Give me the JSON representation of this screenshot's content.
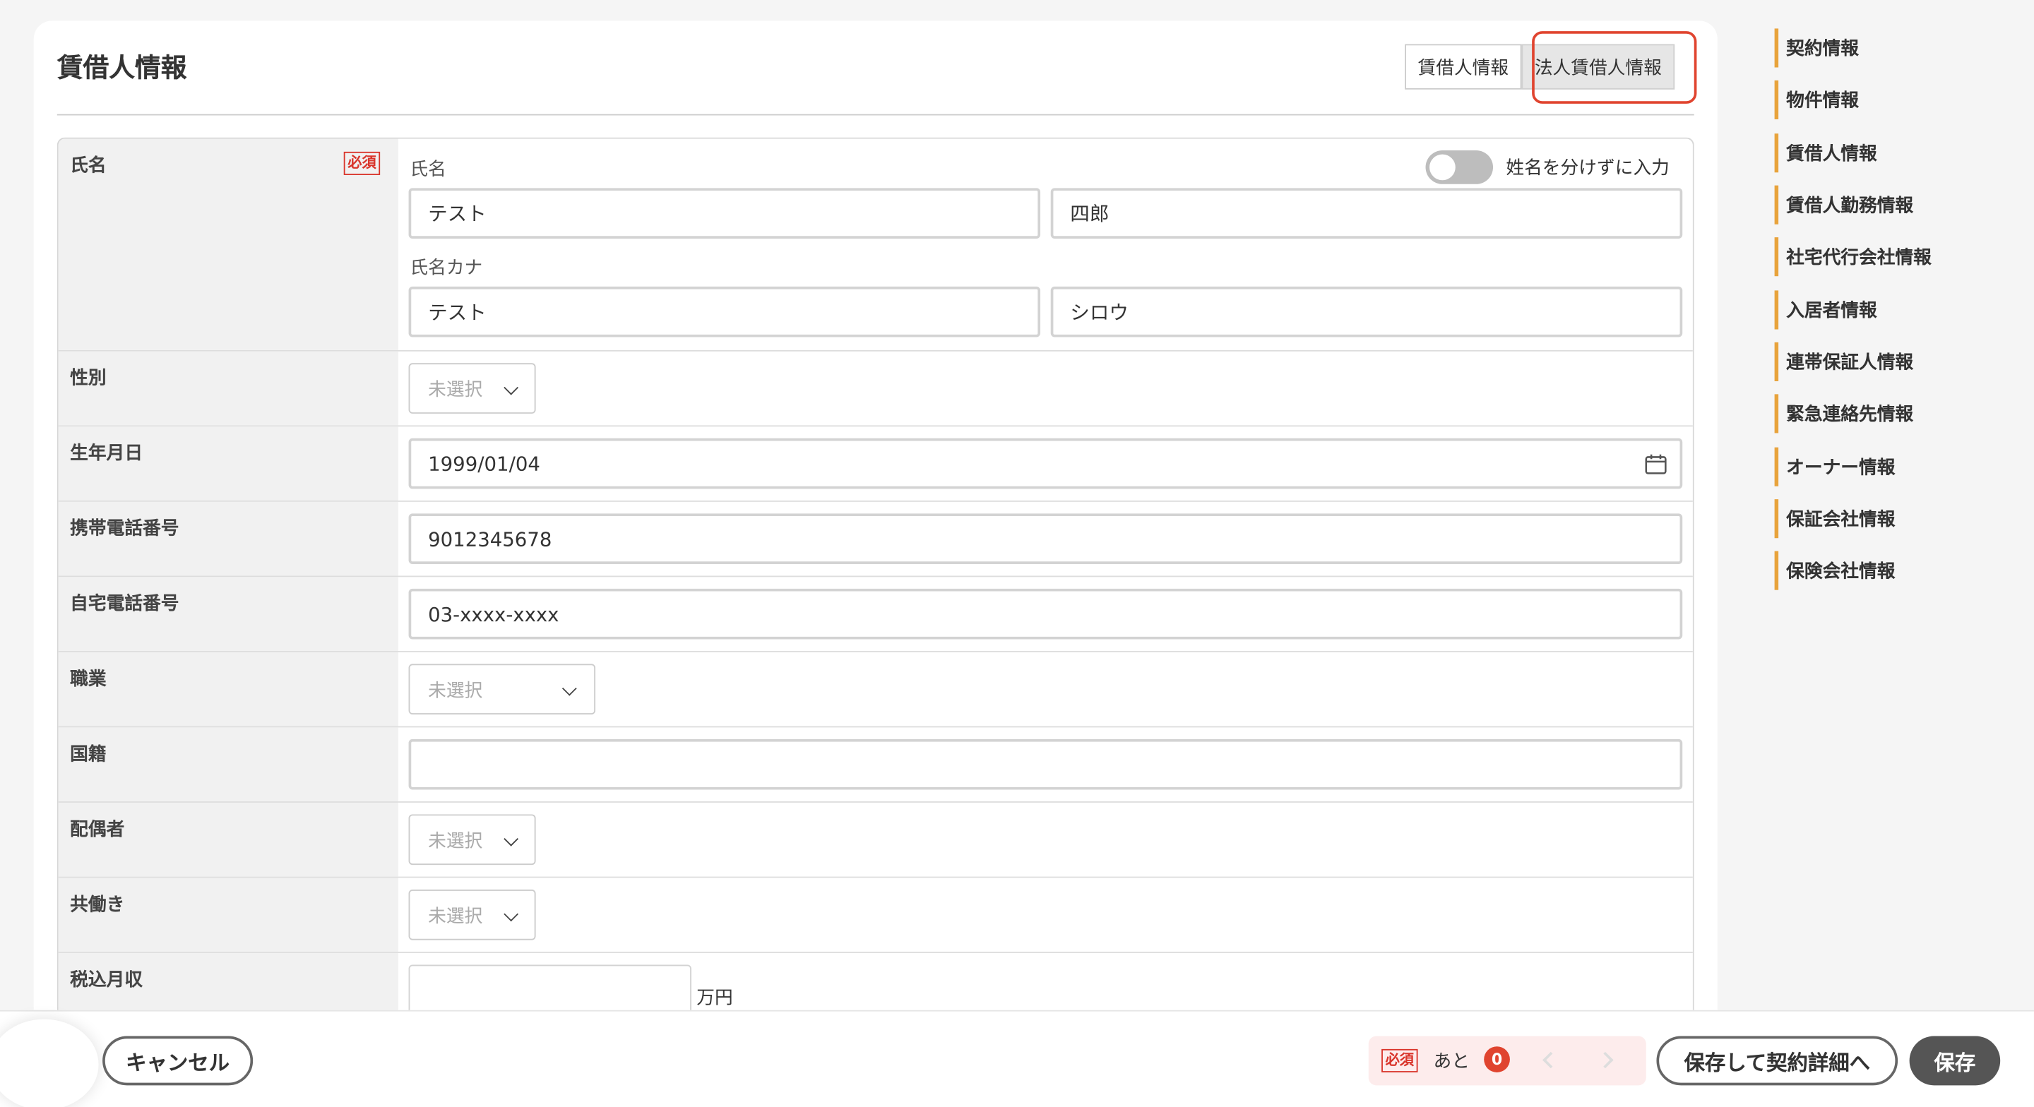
{
  "card": {
    "title": "賃借人情報",
    "tabs": [
      {
        "label": "賃借人情報"
      },
      {
        "label": "法人賃借人情報"
      }
    ]
  },
  "form": {
    "required_badge": "必須",
    "name": {
      "label": "氏名",
      "sub_label_name": "氏名",
      "sub_label_kana": "氏名カナ",
      "toggle_label": "姓名を分けずに入力",
      "last_name": "テスト",
      "first_name": "四郎",
      "last_name_kana": "テスト",
      "first_name_kana": "シロウ"
    },
    "gender": {
      "label": "性別",
      "value": "未選択"
    },
    "birthdate": {
      "label": "生年月日",
      "value": "1999/01/04"
    },
    "mobile": {
      "label": "携帯電話番号",
      "value": "9012345678"
    },
    "home_phone": {
      "label": "自宅電話番号",
      "value": "03-xxxx-xxxx"
    },
    "occupation": {
      "label": "職業",
      "value": "未選択"
    },
    "nationality": {
      "label": "国籍",
      "value": ""
    },
    "spouse": {
      "label": "配偶者",
      "value": "未選択"
    },
    "dual_income": {
      "label": "共働き",
      "value": "未選択"
    },
    "income": {
      "label": "税込月収",
      "value": "",
      "unit": "万円"
    }
  },
  "side_nav": {
    "items": [
      {
        "label": "契約情報"
      },
      {
        "label": "物件情報"
      },
      {
        "label": "賃借人情報"
      },
      {
        "label": "賃借人勤務情報"
      },
      {
        "label": "社宅代行会社情報"
      },
      {
        "label": "入居者情報"
      },
      {
        "label": "連帯保証人情報"
      },
      {
        "label": "緊急連絡先情報"
      },
      {
        "label": "オーナー情報"
      },
      {
        "label": "保証会社情報"
      },
      {
        "label": "保険会社情報"
      }
    ],
    "accent_color": "#e8a33c"
  },
  "footer": {
    "cancel_label": "キャンセル",
    "required_badge": "必須",
    "remaining_prefix": "あと",
    "remaining_count": "0",
    "save_and_detail_label": "保存して契約詳細へ",
    "save_label": "保存"
  },
  "colors": {
    "highlight": "#e0442f",
    "required": "#d9352b",
    "save_button": "#555555"
  }
}
